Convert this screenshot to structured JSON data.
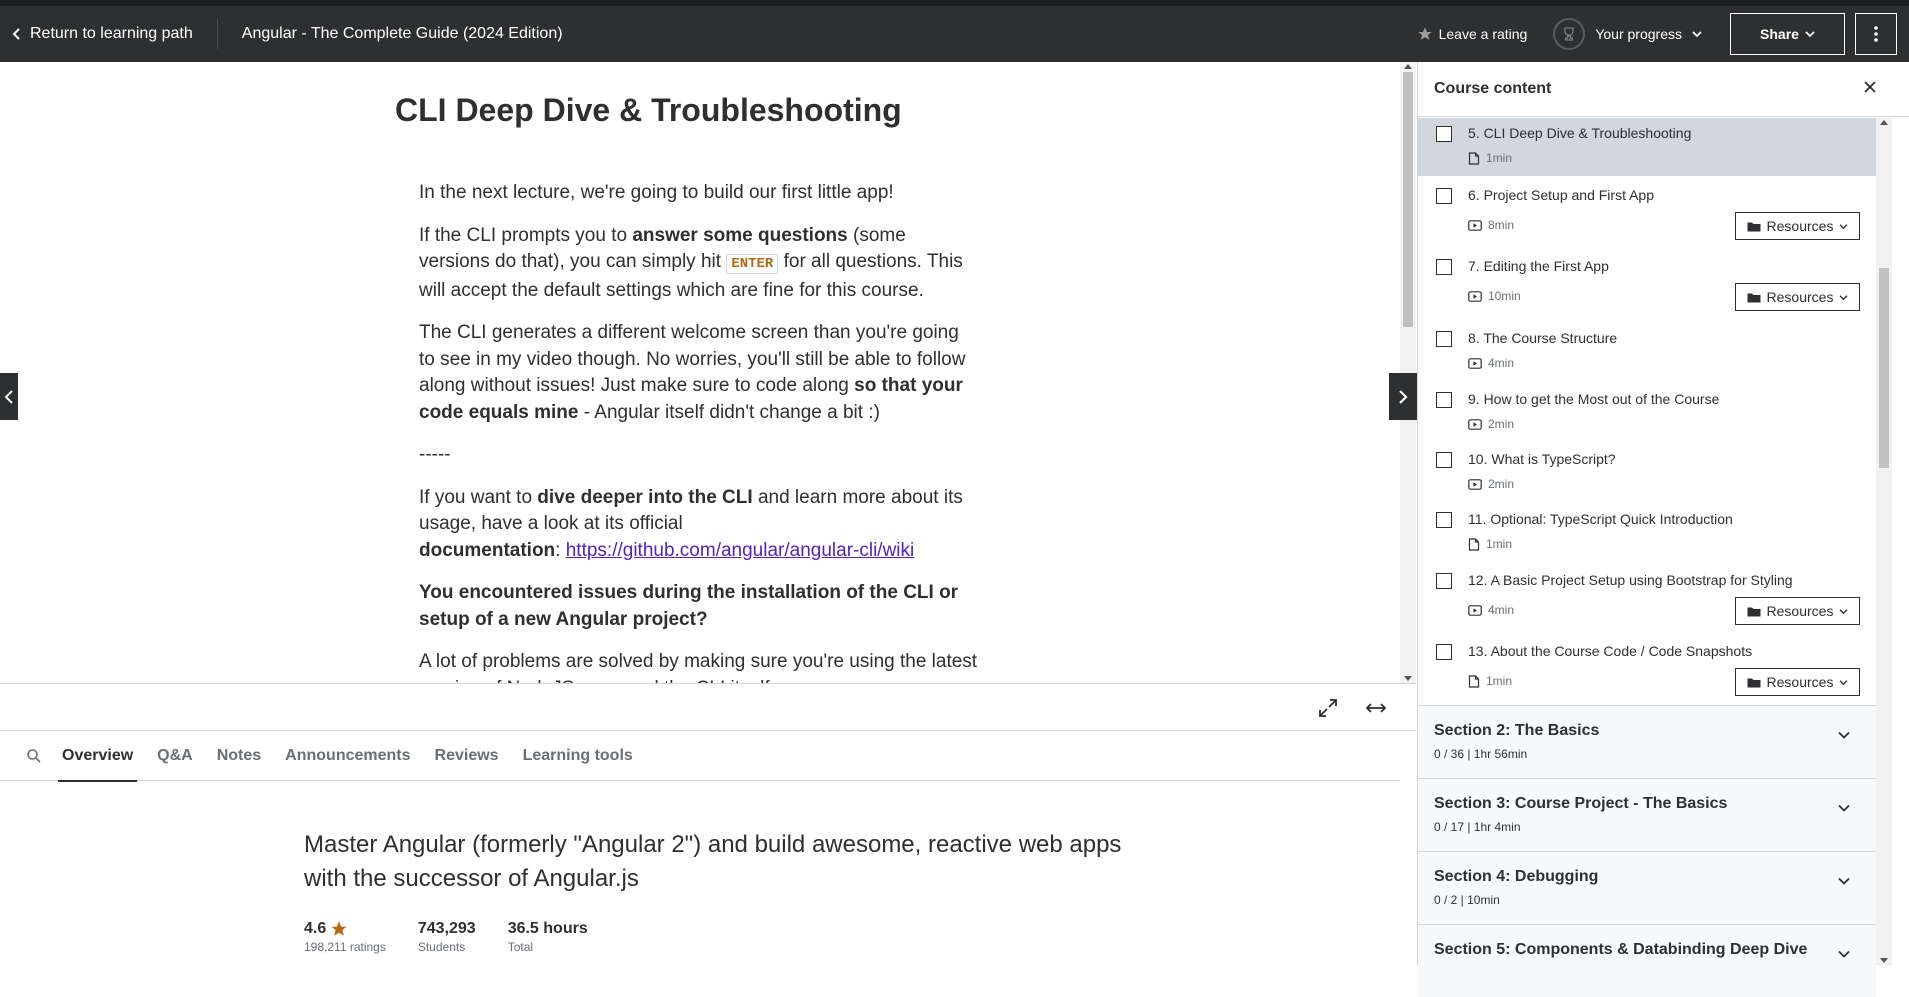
{
  "header": {
    "back_label": "Return to learning path",
    "course_title": "Angular - The Complete Guide (2024 Edition)",
    "rate_label": "Leave a rating",
    "progress_label": "Your progress",
    "share_label": "Share"
  },
  "article": {
    "title": "CLI Deep Dive & Troubleshooting",
    "p1": "In the next lecture, we're going to build our first little app!",
    "p2_a": "If the CLI prompts you to ",
    "p2_b": "answer some questions",
    "p2_c": " (some versions do that), you can simply hit ",
    "p2_code": "ENTER",
    "p2_d": " for all questions. This will accept the default settings which are fine for this course.",
    "p3_a": "The CLI generates a different welcome screen than you're going to see in my video though. No worries, you'll still be able to follow along without issues! Just make sure to code along ",
    "p3_b": "so that your code equals mine",
    "p3_c": " - Angular itself didn't change a bit :)",
    "separator": "-----",
    "p4_a": "If you want to ",
    "p4_b": "dive deeper into the CLI",
    "p4_c": " and learn more about its usage, have a look at its official ",
    "p4_d": "documentation",
    "p4_e": ": ",
    "p4_link": "https://github.com/angular/angular-cli/wiki",
    "p5": "You encountered issues during the installation of the CLI or setup of a new Angular project?",
    "p6": "A lot of problems are solved by making sure you're using the latest version of NodeJS, npm and the CLI itself."
  },
  "tabs": [
    "Overview",
    "Q&A",
    "Notes",
    "Announcements",
    "Reviews",
    "Learning tools"
  ],
  "overview": {
    "headline": "Master Angular (formerly \"Angular 2\") and build awesome, reactive web apps with the successor of Angular.js",
    "rating": "4.6",
    "rating_count": "198,211 ratings",
    "students": "743,293",
    "students_label": "Students",
    "hours": "36.5 hours",
    "hours_label": "Total"
  },
  "sidebar": {
    "title": "Course content",
    "lectures": [
      {
        "title": "5. CLI Deep Dive & Troubleshooting",
        "duration": "1min",
        "icon": "file-icon",
        "resources": false,
        "current": true
      },
      {
        "title": "6. Project Setup and First App",
        "duration": "8min",
        "icon": "video-icon",
        "resources": true
      },
      {
        "title": "7. Editing the First App",
        "duration": "10min",
        "icon": "video-icon",
        "resources": true
      },
      {
        "title": "8. The Course Structure",
        "duration": "4min",
        "icon": "video-icon",
        "resources": false
      },
      {
        "title": "9. How to get the Most out of the Course",
        "duration": "2min",
        "icon": "video-icon",
        "resources": false
      },
      {
        "title": "10. What is TypeScript?",
        "duration": "2min",
        "icon": "video-icon",
        "resources": false
      },
      {
        "title": "11. Optional: TypeScript Quick Introduction",
        "duration": "1min",
        "icon": "file-icon",
        "resources": false
      },
      {
        "title": "12. A Basic Project Setup using Bootstrap for Styling",
        "duration": "4min",
        "icon": "video-icon",
        "resources": true
      },
      {
        "title": "13. About the Course Code / Code Snapshots",
        "duration": "1min",
        "icon": "file-icon",
        "resources": true
      }
    ],
    "resources_label": "Resources",
    "sections": [
      {
        "title": "Section 2: The Basics",
        "meta": "0 / 36 | 1hr 56min"
      },
      {
        "title": "Section 3: Course Project - The Basics",
        "meta": "0 / 17 | 1hr 4min"
      },
      {
        "title": "Section 4: Debugging",
        "meta": "0 / 2 | 10min"
      },
      {
        "title": "Section 5: Components & Databinding Deep Dive",
        "meta": ""
      }
    ]
  },
  "colors": {
    "header_bg": "#2d2f31",
    "link": "#5022c3",
    "star": "#b4690e",
    "current_bg": "#d1d7dc"
  }
}
